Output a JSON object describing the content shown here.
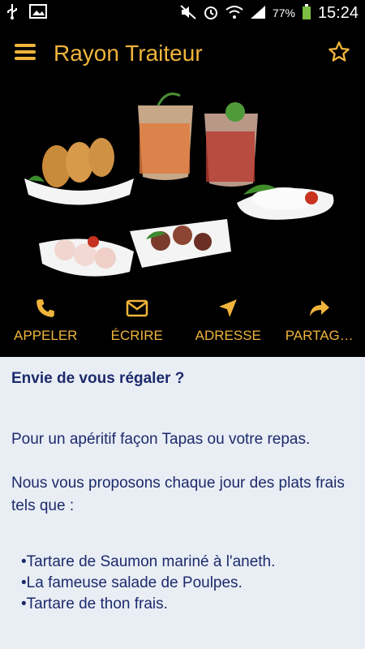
{
  "statusbar": {
    "battery": "77%",
    "time": "15:24"
  },
  "appbar": {
    "title": "Rayon Traiteur",
    "menu_icon": "hamburger-icon",
    "favorite_icon": "star-icon"
  },
  "actions": [
    {
      "label": "APPELER",
      "icon": "phone-icon"
    },
    {
      "label": "ÉCRIRE",
      "icon": "envelope-icon"
    },
    {
      "label": "ADRESSE",
      "icon": "navigation-arrow-icon"
    },
    {
      "label": "PARTAG…",
      "icon": "share-icon"
    }
  ],
  "content": {
    "headline": "Envie de vous régaler ?",
    "para1": "Pour un apéritif façon Tapas ou votre repas.",
    "para2": "Nous vous proposons chaque jour des plats frais tels que :",
    "items": [
      "•Tartare de Saumon mariné à l'aneth.",
      "•La fameuse salade de Poulpes.",
      "•Tartare de thon frais."
    ]
  },
  "colors": {
    "accent": "#f0b43c",
    "text": "#1c2a6b",
    "content_bg": "#e9eef5"
  }
}
